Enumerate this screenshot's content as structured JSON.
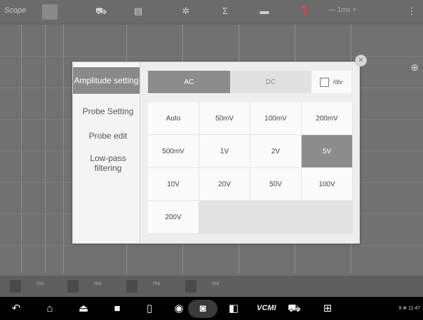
{
  "app": {
    "title": "Scope",
    "time_readout": "— 1ms +"
  },
  "channel_strip": {
    "labels": [
      "ms",
      "ms",
      "ms",
      "ms"
    ]
  },
  "nav_bar": {
    "vcmi_label": "VCMI",
    "status": "9 ⊕ 11:47"
  },
  "dialog": {
    "menu": [
      {
        "label": "Amplitude setting",
        "active": true
      },
      {
        "label": "Probe Setting",
        "active": false
      },
      {
        "label": "Probe edit",
        "active": false
      },
      {
        "label": "Low-pass filtering",
        "active": false
      }
    ],
    "coupling_tabs": [
      {
        "label": "AC",
        "selected": true
      },
      {
        "label": "DC",
        "selected": false
      }
    ],
    "per_div_label": "/div",
    "per_div_checked": false,
    "ranges": [
      [
        "Auto",
        "50mV",
        "100mV",
        "200mV"
      ],
      [
        "500mV",
        "1V",
        "2V",
        "5V"
      ],
      [
        "10V",
        "20V",
        "50V",
        "100V"
      ],
      [
        "200V"
      ]
    ],
    "selected_range": "5V"
  },
  "colors": {
    "active_gray": "#8c8c8c",
    "background": "#6f6f6f"
  }
}
